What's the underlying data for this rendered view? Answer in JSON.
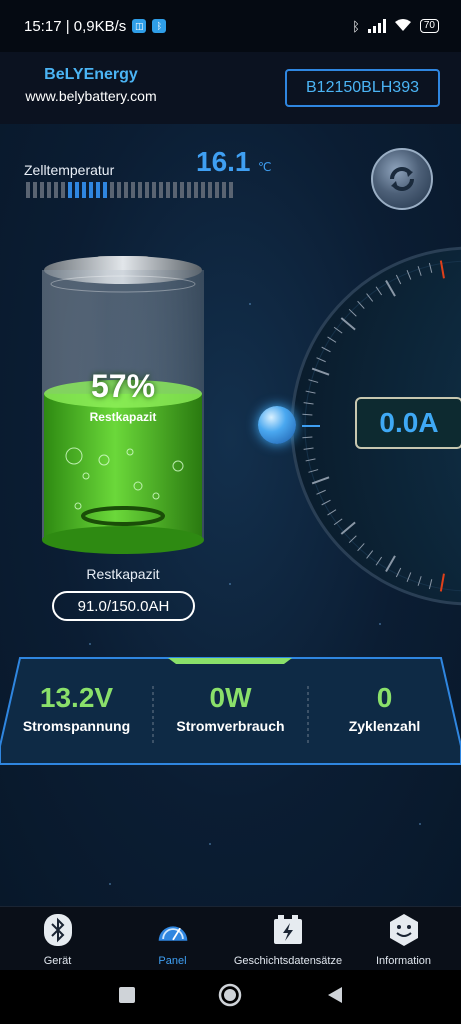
{
  "status_bar": {
    "time_info": "15:17 | 0,9KB/s",
    "battery_level": "70"
  },
  "header": {
    "brand_name": "BeLYEnergy",
    "brand_url": "www.belybattery.com",
    "device_id": "B12150BLH393"
  },
  "temperature": {
    "label": "Zelltemperatur",
    "value": "16.1",
    "unit": "℃",
    "segments_total": 30,
    "segments_active": 12
  },
  "battery": {
    "percent": "57%",
    "percent_label": "Restkapazit",
    "level_fraction": 0.57,
    "label": "Restkapazit",
    "capacity": "91.0/150.0AH"
  },
  "current": {
    "value": "0.0A"
  },
  "stats": [
    {
      "value": "13.2V",
      "label": "Stromspannung"
    },
    {
      "value": "0W",
      "label": "Stromverbrauch"
    },
    {
      "value": "0",
      "label": "Zyklenzahl"
    }
  ],
  "nav": {
    "items": [
      {
        "label": "Gerät",
        "icon": "bluetooth-icon"
      },
      {
        "label": "Panel",
        "icon": "speedometer-icon",
        "active": true
      },
      {
        "label": "Geschichtsdatensätze",
        "icon": "battery-history-icon"
      },
      {
        "label": "Information",
        "icon": "info-face-icon"
      }
    ]
  },
  "colors": {
    "accent_blue": "#3f9ff2",
    "value_green": "#8ae06a",
    "gauge_red": "#e0401a"
  }
}
